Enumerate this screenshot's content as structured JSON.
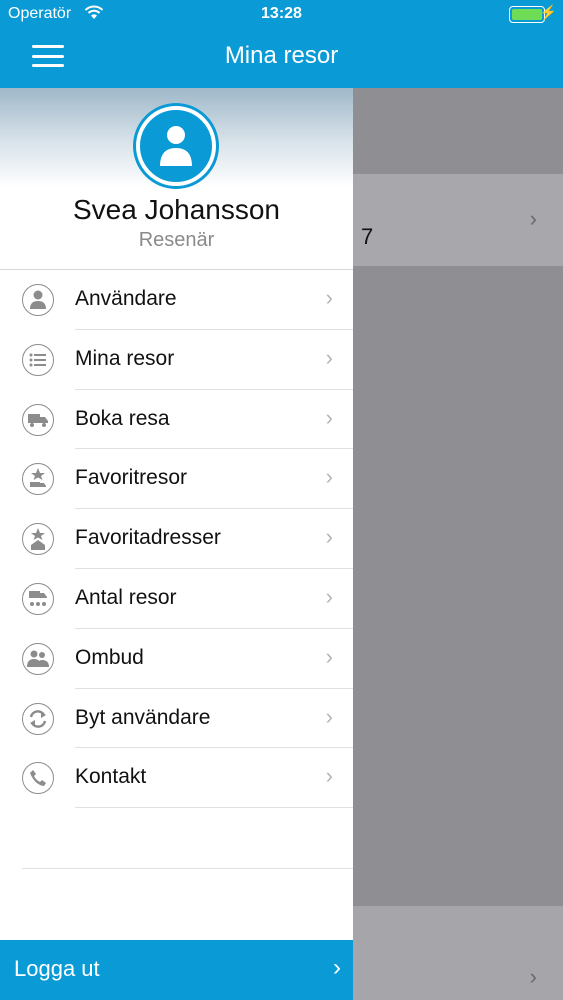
{
  "status_bar": {
    "carrier": "Operatör",
    "time": "13:28"
  },
  "header": {
    "title": "Mina resor"
  },
  "profile": {
    "name": "Svea Johansson",
    "role": "Resenär"
  },
  "menu": [
    {
      "label": "Användare",
      "icon": "user-icon"
    },
    {
      "label": "Mina resor",
      "icon": "list-icon"
    },
    {
      "label": "Boka resa",
      "icon": "truck-icon"
    },
    {
      "label": "Favoritresor",
      "icon": "star-truck-icon"
    },
    {
      "label": "Favoritadresser",
      "icon": "star-house-icon"
    },
    {
      "label": "Antal resor",
      "icon": "count-trips-icon"
    },
    {
      "label": "Ombud",
      "icon": "people-icon"
    },
    {
      "label": "Byt användare",
      "icon": "switch-user-icon"
    },
    {
      "label": "Kontakt",
      "icon": "phone-icon"
    }
  ],
  "logout": {
    "label": "Logga ut"
  },
  "background": {
    "number": "7"
  },
  "colors": {
    "primary": "#0a9ad6",
    "battery": "#6fdc55"
  }
}
